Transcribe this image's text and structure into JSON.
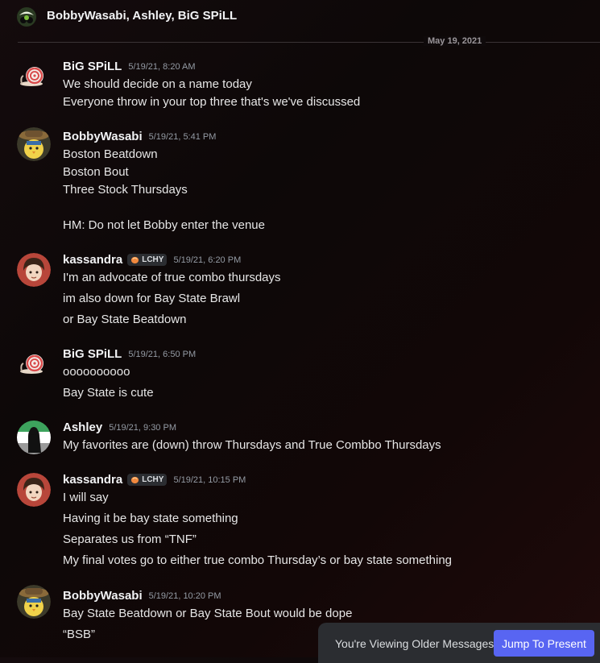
{
  "header": {
    "title": "BobbyWasabi, Ashley, BiG SPiLL",
    "icon": "group-dm-icon"
  },
  "divider": {
    "date": "May 19, 2021"
  },
  "messages": [
    {
      "author": "BiG SPiLL",
      "timestamp": "5/19/21, 8:20 AM",
      "avatar": "snail-avatar",
      "lines": [
        "We should decide on a name today",
        "Everyone throw in your top three that's we've discussed"
      ]
    },
    {
      "author": "BobbyWasabi",
      "timestamp": "5/19/21, 5:41 PM",
      "avatar": "bird-with-hat-avatar",
      "lines": [
        "Boston Beatdown",
        "Boston Bout",
        "Three Stock Thursdays",
        "",
        "HM: Do not let Bobby enter the venue"
      ]
    },
    {
      "author": "kassandra",
      "tag": "LCHY",
      "timestamp": "5/19/21, 6:20 PM",
      "avatar": "anime-character-avatar",
      "lines": [
        "I'm an advocate of true combo thursdays",
        "im also down for Bay State Brawl",
        "or Bay State Beatdown"
      ]
    },
    {
      "author": "BiG SPiLL",
      "timestamp": "5/19/21, 6:50 PM",
      "avatar": "snail-avatar",
      "lines": [
        "oooooooooo",
        "Bay State is cute"
      ]
    },
    {
      "author": "Ashley",
      "timestamp": "5/19/21, 9:30 PM",
      "avatar": "dark-figure-flag-avatar",
      "lines": [
        "My favorites are (down) throw Thursdays and True Combbo Thursdays"
      ]
    },
    {
      "author": "kassandra",
      "tag": "LCHY",
      "timestamp": "5/19/21, 10:15 PM",
      "avatar": "anime-character-avatar",
      "lines": [
        "I will say",
        "Having it be bay state something",
        "Separates us from “TNF”",
        "My final votes go to either true combo Thursday’s or bay state something"
      ]
    },
    {
      "author": "BobbyWasabi",
      "timestamp": "5/19/21, 10:20 PM",
      "avatar": "bird-with-hat-avatar",
      "lines": [
        "Bay State Beatdown or Bay State Bout would be dope",
        "“BSB”"
      ]
    }
  ],
  "banner": {
    "text": "You're Viewing Older Messages",
    "button": "Jump To Present"
  },
  "colors": {
    "accent": "#5865f2",
    "tag_icon": "#f0883e"
  }
}
